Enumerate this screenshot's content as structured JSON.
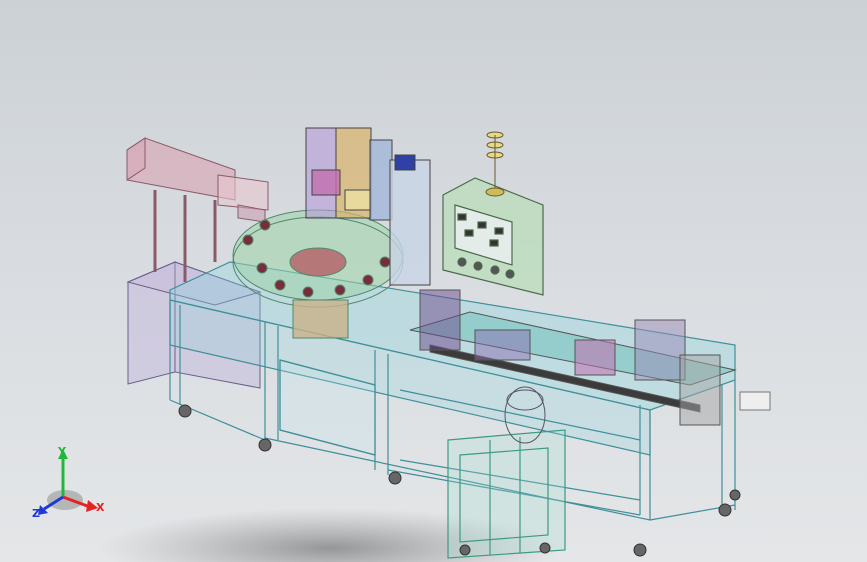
{
  "triad": {
    "x_label": "X",
    "y_label": "Y",
    "z_label": "Z",
    "x_color": "#e52222",
    "y_color": "#1fb83a",
    "z_color": "#1d3ad6"
  },
  "scene": {
    "background_top": "#ccd1d6",
    "background_bottom": "#e4e6e8",
    "frame_color": "#86d3dc",
    "panel_color": "#7ecfcf",
    "control_box_color": "#b8ddb6",
    "hopper_color": "#d9a3b2",
    "enclosure_color": "#c2b4dc",
    "icons": [
      "rotary-table",
      "feeder-hopper",
      "control-panel",
      "stack-light",
      "conveyor",
      "leveling-foot"
    ]
  }
}
